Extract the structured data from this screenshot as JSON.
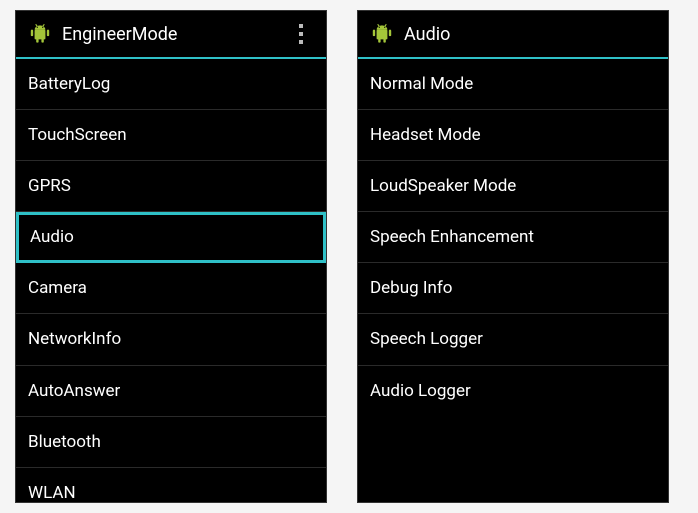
{
  "left": {
    "title": "EngineerMode",
    "selected": "Audio",
    "items": [
      "BatteryLog",
      "TouchScreen",
      "GPRS",
      "Audio",
      "Camera",
      "NetworkInfo",
      "AutoAnswer",
      "Bluetooth",
      "WLAN"
    ]
  },
  "right": {
    "title": "Audio",
    "items": [
      "Normal Mode",
      "Headset Mode",
      "LoudSpeaker Mode",
      "Speech Enhancement",
      "Debug Info",
      "Speech Logger",
      "Audio Logger"
    ]
  },
  "colors": {
    "accent": "#2fc0c7"
  }
}
